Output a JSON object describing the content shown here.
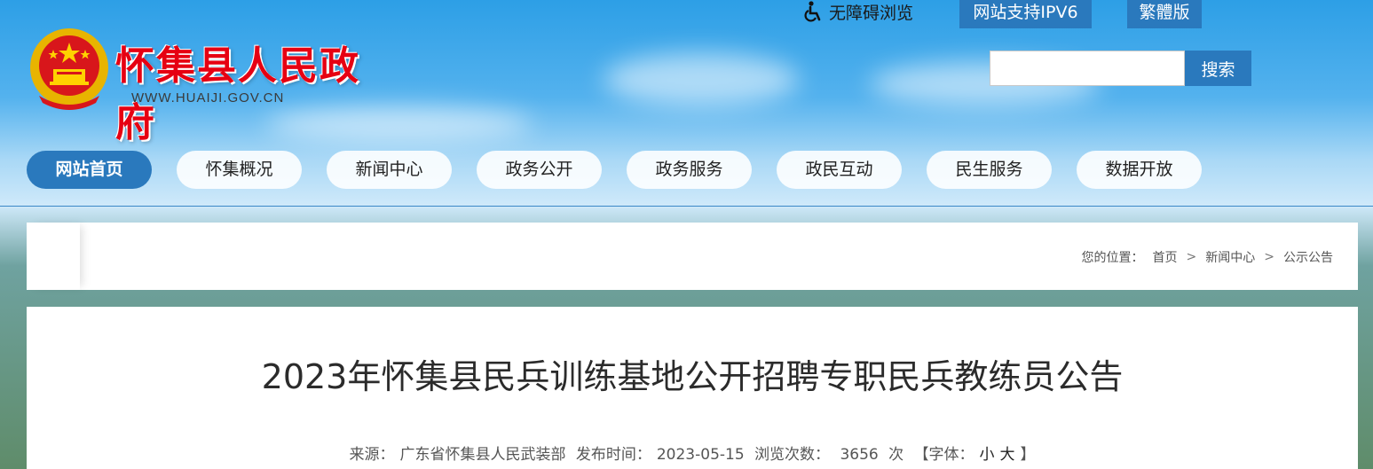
{
  "top_bar": {
    "accessibility_label": "无障碍浏览",
    "ipv6_label": "网站支持IPV6",
    "traditional_label": "繁體版"
  },
  "header": {
    "site_name": "怀集县人民政府",
    "site_url": "WWW.HUAIJI.GOV.CN",
    "search_placeholder": "",
    "search_button": "搜索"
  },
  "nav": {
    "items": [
      {
        "label": "网站首页"
      },
      {
        "label": "怀集概况"
      },
      {
        "label": "新闻中心"
      },
      {
        "label": "政务公开"
      },
      {
        "label": "政务服务"
      },
      {
        "label": "政民互动"
      },
      {
        "label": "民生服务"
      },
      {
        "label": "数据开放"
      }
    ]
  },
  "breadcrumb": {
    "prefix": "您的位置：",
    "items": [
      "首页",
      "新闻中心",
      "公示公告"
    ],
    "separator": ">"
  },
  "article": {
    "title": "2023年怀集县民兵训练基地公开招聘专职民兵教练员公告",
    "source_label": "来源：",
    "source": "广东省怀集县人民武装部",
    "date_label": "发布时间：",
    "date": "2023-05-15",
    "views_label": "浏览次数：",
    "views": "3656",
    "views_unit": "次",
    "font_label": "【字体：",
    "font_small": "小",
    "font_large": "大",
    "font_close": "】"
  },
  "colors": {
    "primary_blue": "#2a79bd",
    "site_name_red": "#e60012"
  }
}
